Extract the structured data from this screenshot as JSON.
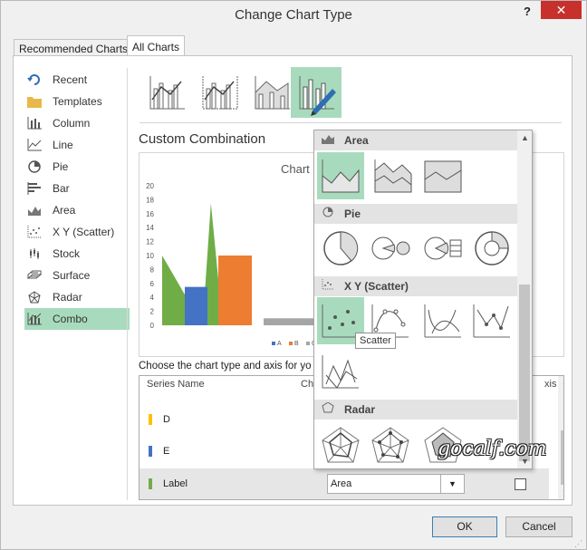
{
  "window": {
    "title": "Change Chart Type",
    "help_label": "?",
    "close_label": "✕"
  },
  "tabs": [
    {
      "label": "Recommended Charts"
    },
    {
      "label": "All Charts"
    }
  ],
  "nav": {
    "items": [
      {
        "label": "Recent",
        "icon": "recent-icon"
      },
      {
        "label": "Templates",
        "icon": "folder-icon"
      },
      {
        "label": "Column",
        "icon": "column-chart-icon"
      },
      {
        "label": "Line",
        "icon": "line-chart-icon"
      },
      {
        "label": "Pie",
        "icon": "pie-chart-icon"
      },
      {
        "label": "Bar",
        "icon": "bar-chart-icon"
      },
      {
        "label": "Area",
        "icon": "area-chart-icon"
      },
      {
        "label": "X Y (Scatter)",
        "icon": "scatter-chart-icon"
      },
      {
        "label": "Stock",
        "icon": "stock-chart-icon"
      },
      {
        "label": "Surface",
        "icon": "surface-chart-icon"
      },
      {
        "label": "Radar",
        "icon": "radar-chart-icon"
      },
      {
        "label": "Combo",
        "icon": "combo-chart-icon"
      }
    ],
    "selected": "Combo"
  },
  "main": {
    "section_title": "Custom Combination",
    "chart_title": "Chart",
    "choose_label": "Choose the chart type and axis for yo",
    "series_headers": {
      "name": "Series Name",
      "type": "Cha",
      "axis": "xis"
    }
  },
  "chart_data": {
    "type": "bar",
    "title": "Chart",
    "ylim": [
      0,
      20
    ],
    "yticks": [
      "0",
      "2",
      "4",
      "6",
      "8",
      "10",
      "12",
      "14",
      "16",
      "18",
      "20"
    ],
    "legend": [
      "A",
      "B",
      "C"
    ],
    "colors": {
      "A": "#4472c4",
      "B": "#ed7d31",
      "C": "#a5a5a5",
      "Label": "#70ad47"
    },
    "area_values": [
      10,
      0,
      17.5,
      0
    ],
    "series": [
      {
        "name": "A",
        "values": [
          5.5
        ]
      },
      {
        "name": "B",
        "values": [
          10
        ]
      },
      {
        "name": "C",
        "values": [
          1
        ]
      }
    ]
  },
  "series_rows": [
    {
      "name": "D",
      "color": "#ffc000"
    },
    {
      "name": "E",
      "color": "#4472c4"
    },
    {
      "name": "Label",
      "color": "#70ad47",
      "type": "Area"
    }
  ],
  "popup": {
    "sections": [
      {
        "title": "Area",
        "icon": "area-chart-icon"
      },
      {
        "title": "Pie",
        "icon": "pie-chart-icon"
      },
      {
        "title": "X Y (Scatter)",
        "icon": "scatter-chart-icon"
      },
      {
        "title": "Radar",
        "icon": "radar-chart-icon"
      }
    ],
    "tooltip": "Scatter"
  },
  "watermark": "gocalf.com",
  "buttons": {
    "ok": "OK",
    "cancel": "Cancel"
  }
}
